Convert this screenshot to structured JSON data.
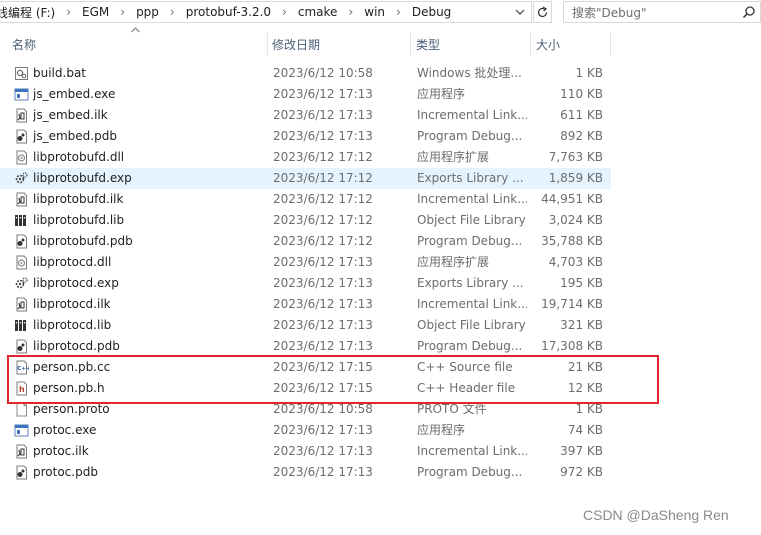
{
  "address": {
    "crumbs": [
      "线编程 (F:)",
      "EGM",
      "ppp",
      "protobuf-3.2.0",
      "cmake",
      "win",
      "Debug"
    ],
    "search_placeholder": "搜索\"Debug\""
  },
  "columns": {
    "name": "名称",
    "date": "修改日期",
    "type": "类型",
    "size": "大小"
  },
  "files": [
    {
      "name": "build.bat",
      "date": "2023/6/12 10:58",
      "type": "Windows 批处理...",
      "size": "1 KB",
      "icon": "batch-file-icon"
    },
    {
      "name": "js_embed.exe",
      "date": "2023/6/12 17:13",
      "type": "应用程序",
      "size": "110 KB",
      "icon": "exe-icon"
    },
    {
      "name": "js_embed.ilk",
      "date": "2023/6/12 17:13",
      "type": "Incremental Link...",
      "size": "611 KB",
      "icon": "ilk-file-icon"
    },
    {
      "name": "js_embed.pdb",
      "date": "2023/6/12 17:13",
      "type": "Program Debug...",
      "size": "892 KB",
      "icon": "pdb-file-icon"
    },
    {
      "name": "libprotobufd.dll",
      "date": "2023/6/12 17:12",
      "type": "应用程序扩展",
      "size": "7,763 KB",
      "icon": "dll-file-icon"
    },
    {
      "name": "libprotobufd.exp",
      "date": "2023/6/12 17:12",
      "type": "Exports Library ...",
      "size": "1,859 KB",
      "icon": "exp-file-icon"
    },
    {
      "name": "libprotobufd.ilk",
      "date": "2023/6/12 17:12",
      "type": "Incremental Link...",
      "size": "44,951 KB",
      "icon": "ilk-file-icon"
    },
    {
      "name": "libprotobufd.lib",
      "date": "2023/6/12 17:12",
      "type": "Object File Library",
      "size": "3,024 KB",
      "icon": "lib-file-icon"
    },
    {
      "name": "libprotobufd.pdb",
      "date": "2023/6/12 17:12",
      "type": "Program Debug...",
      "size": "35,788 KB",
      "icon": "pdb-file-icon"
    },
    {
      "name": "libprotocd.dll",
      "date": "2023/6/12 17:13",
      "type": "应用程序扩展",
      "size": "4,703 KB",
      "icon": "dll-file-icon"
    },
    {
      "name": "libprotocd.exp",
      "date": "2023/6/12 17:13",
      "type": "Exports Library ...",
      "size": "195 KB",
      "icon": "exp-file-icon"
    },
    {
      "name": "libprotocd.ilk",
      "date": "2023/6/12 17:13",
      "type": "Incremental Link...",
      "size": "19,714 KB",
      "icon": "ilk-file-icon"
    },
    {
      "name": "libprotocd.lib",
      "date": "2023/6/12 17:13",
      "type": "Object File Library",
      "size": "321 KB",
      "icon": "lib-file-icon"
    },
    {
      "name": "libprotocd.pdb",
      "date": "2023/6/12 17:13",
      "type": "Program Debug...",
      "size": "17,308 KB",
      "icon": "pdb-file-icon"
    },
    {
      "name": "person.pb.cc",
      "date": "2023/6/12 17:15",
      "type": "C++ Source file",
      "size": "21 KB",
      "icon": "cpp-source-icon"
    },
    {
      "name": "person.pb.h",
      "date": "2023/6/12 17:15",
      "type": "C++ Header file",
      "size": "12 KB",
      "icon": "cpp-header-icon"
    },
    {
      "name": "person.proto",
      "date": "2023/6/12 10:58",
      "type": "PROTO 文件",
      "size": "1 KB",
      "icon": "blank-file-icon"
    },
    {
      "name": "protoc.exe",
      "date": "2023/6/12 17:13",
      "type": "应用程序",
      "size": "74 KB",
      "icon": "exe-icon"
    },
    {
      "name": "protoc.ilk",
      "date": "2023/6/12 17:13",
      "type": "Incremental Link...",
      "size": "397 KB",
      "icon": "ilk-file-icon"
    },
    {
      "name": "protoc.pdb",
      "date": "2023/6/12 17:13",
      "type": "Program Debug...",
      "size": "972 KB",
      "icon": "pdb-file-icon"
    }
  ],
  "selected_index": 5,
  "colors": {
    "highlight_border": "#e0262f",
    "selection_bg": "#e5f3ff",
    "header_text": "#4c607a"
  },
  "watermark": "CSDN @DaSheng Ren"
}
